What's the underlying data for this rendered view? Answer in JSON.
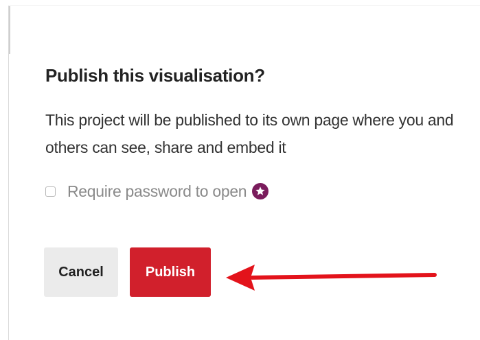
{
  "dialog": {
    "title": "Publish this visualisation?",
    "description": "This project will be published to its own page where you and others can see, share and embed it",
    "password_option": {
      "label": "Require password to open",
      "checked": false,
      "badge_icon": "star-icon",
      "badge_color": "#7a1c5c"
    },
    "buttons": {
      "cancel_label": "Cancel",
      "publish_label": "Publish"
    }
  },
  "colors": {
    "publish_button": "#d1202c",
    "cancel_button": "#ebebeb",
    "annotation_arrow": "#e3131b"
  },
  "annotation": {
    "icon": "arrow-left-icon"
  }
}
